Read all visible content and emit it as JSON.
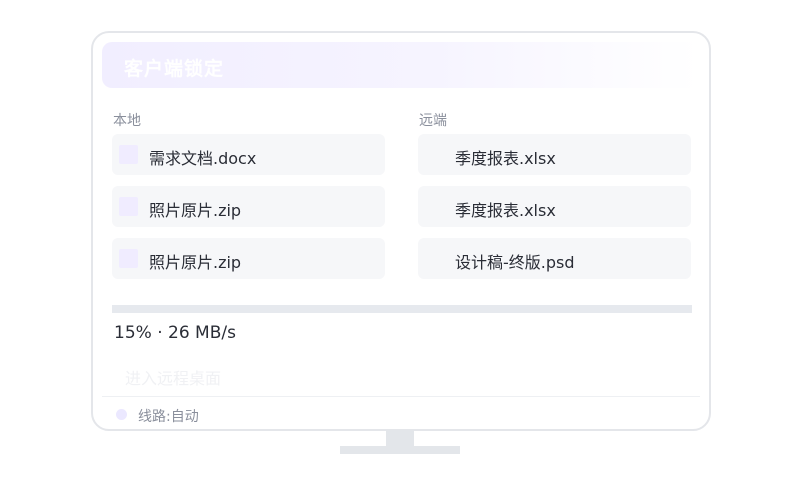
{
  "header": {
    "title": "客户端锁定"
  },
  "local": {
    "label": "本地",
    "files": [
      {
        "name": "需求文档.docx"
      },
      {
        "name": "照片原片.zip"
      },
      {
        "name": "照片原片.zip"
      }
    ]
  },
  "remote": {
    "label": "远端",
    "files": [
      {
        "name": "季度报表.xlsx"
      },
      {
        "name": "季度报表.xlsx"
      },
      {
        "name": "设计稿-终版.psd"
      }
    ]
  },
  "transfer": {
    "progress_percent": 15,
    "status_text": "15% · 26 MB/s"
  },
  "actions": {
    "enter_remote_label": "进入远程桌面"
  },
  "footer": {
    "route_text": "线路:自动"
  },
  "colors": {
    "accent_light": "#f1eeff",
    "card_bg": "#f6f7f9",
    "text_primary": "#2a2d36",
    "text_muted": "#8a8f9c"
  }
}
